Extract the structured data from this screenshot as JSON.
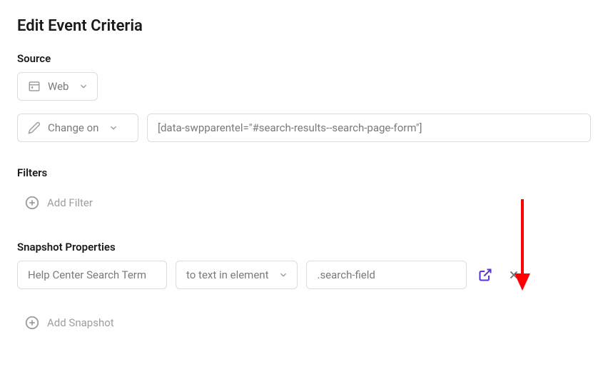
{
  "pageTitle": "Edit Event Criteria",
  "source": {
    "label": "Source",
    "platformLabel": "Web",
    "triggerLabel": "Change on",
    "selectorValue": "[data-swpparentel=\"#search-results--search-page-form\"]"
  },
  "filters": {
    "label": "Filters",
    "addLabel": "Add Filter"
  },
  "snapshot": {
    "label": "Snapshot Properties",
    "nameValue": "",
    "namePlaceholder": "Help Center Search Term",
    "bindingLabel": "to text in element",
    "selectorValue": ".search-field",
    "addLabel": "Add Snapshot"
  }
}
